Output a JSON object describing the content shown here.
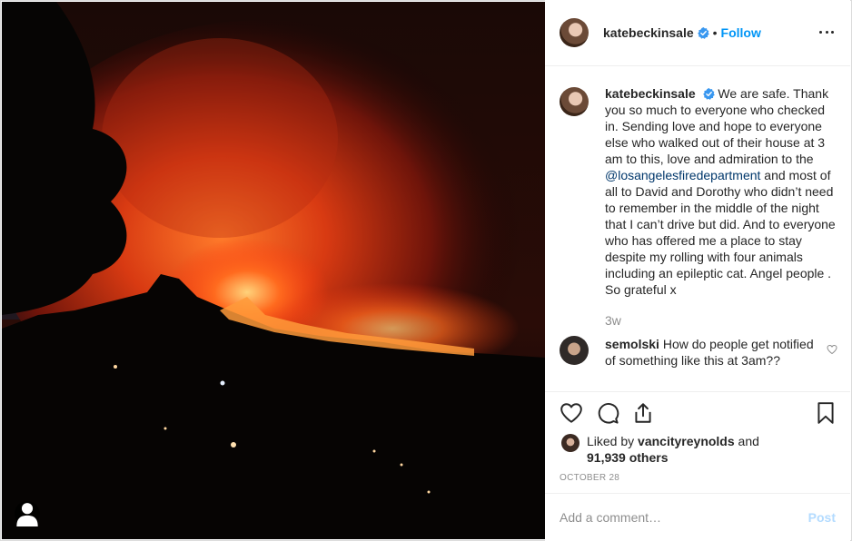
{
  "post": {
    "author": "katebeckinsale",
    "verified": true,
    "separator": "•",
    "follow_label": "Follow"
  },
  "caption": {
    "username": "katebeckinsale",
    "text_before": "We are safe. Thank you so much to everyone who checked in. Sending love and hope to everyone else who walked out of their house at 3 am to this, love and admiration to the ",
    "mention": "@losangelesfiredepartment",
    "text_after": " and most of all to David and Dorothy who didn’t need to remember in the middle of the night that I can’t drive but did. And to everyone who has offered me a place to stay despite my rolling with four animals including an epileptic cat. Angel people . So grateful x",
    "age": "3w"
  },
  "comments": [
    {
      "username": "semolski",
      "text": "How do people get notified of something like this at 3am??"
    }
  ],
  "likes": {
    "prefix": "Liked by",
    "user": "vancityreynolds",
    "conjunction": "and",
    "others": "91,939 others"
  },
  "date": "OCTOBER 28",
  "add_comment": {
    "placeholder": "Add a comment…",
    "post_label": "Post"
  },
  "icons": {
    "like": "heart-icon",
    "comment": "comment-bubble-icon",
    "share": "share-icon",
    "save": "bookmark-icon",
    "more": "more-options-icon",
    "tag": "user-tag-icon"
  },
  "colors": {
    "link_blue": "#0095f6",
    "mention": "#00376b",
    "muted": "#8e8e8e",
    "post_disabled": "#b3dbff"
  }
}
